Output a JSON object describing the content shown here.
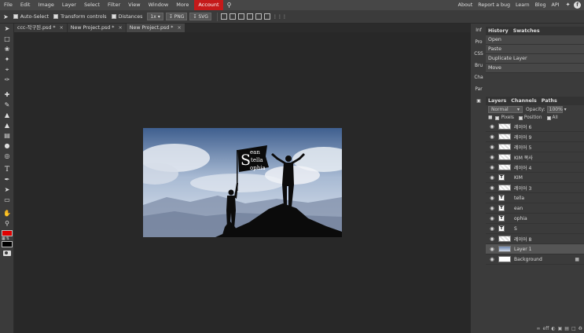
{
  "menubar": {
    "items": [
      "File",
      "Edit",
      "Image",
      "Layer",
      "Select",
      "Filter",
      "View",
      "Window",
      "More"
    ],
    "account": "Account",
    "right": [
      "About",
      "Report a bug",
      "Learn",
      "Blog",
      "API"
    ]
  },
  "options": {
    "auto_select": "Auto-Select",
    "transform_controls": "Transform controls",
    "distances": "Distances",
    "zoom": "1x",
    "png": "PNG",
    "svg": "SVG"
  },
  "tabs": [
    {
      "label": "ccc-작구된.psd *"
    },
    {
      "label": "New Project.psd *"
    },
    {
      "label": "New Project.psd *"
    }
  ],
  "sidenav": [
    "Inf",
    "Pro",
    "CSS",
    "Bru",
    "Cha",
    "Par"
  ],
  "history": {
    "tabs": [
      "History",
      "Swatches"
    ],
    "items": [
      "Open",
      "Paste",
      "Duplicate Layer",
      "Move"
    ]
  },
  "layers": {
    "tabs": [
      "Layers",
      "Channels",
      "Paths"
    ],
    "blend_mode": "Normal",
    "opacity_label": "Opacity:",
    "opacity_value": "100%",
    "lock_labels": [
      "Pixels",
      "Position",
      "All"
    ],
    "rows": [
      {
        "name": "레이어 6",
        "type": "raster"
      },
      {
        "name": "레이어 9",
        "type": "raster"
      },
      {
        "name": "레이어 5",
        "type": "raster"
      },
      {
        "name": "KIM 복사",
        "type": "raster"
      },
      {
        "name": "레이어 4",
        "type": "raster"
      },
      {
        "name": "KIM",
        "type": "text"
      },
      {
        "name": "레이어 3",
        "type": "raster"
      },
      {
        "name": "tella",
        "type": "text"
      },
      {
        "name": "ean",
        "type": "text"
      },
      {
        "name": "ophia",
        "type": "text"
      },
      {
        "name": "S",
        "type": "text"
      },
      {
        "name": "레이어 8",
        "type": "raster"
      },
      {
        "name": "Layer 1",
        "type": "image"
      },
      {
        "name": "Background",
        "type": "white"
      }
    ]
  },
  "canvas": {
    "flag_text": [
      "S",
      "ean",
      "tella",
      "ophia"
    ]
  }
}
